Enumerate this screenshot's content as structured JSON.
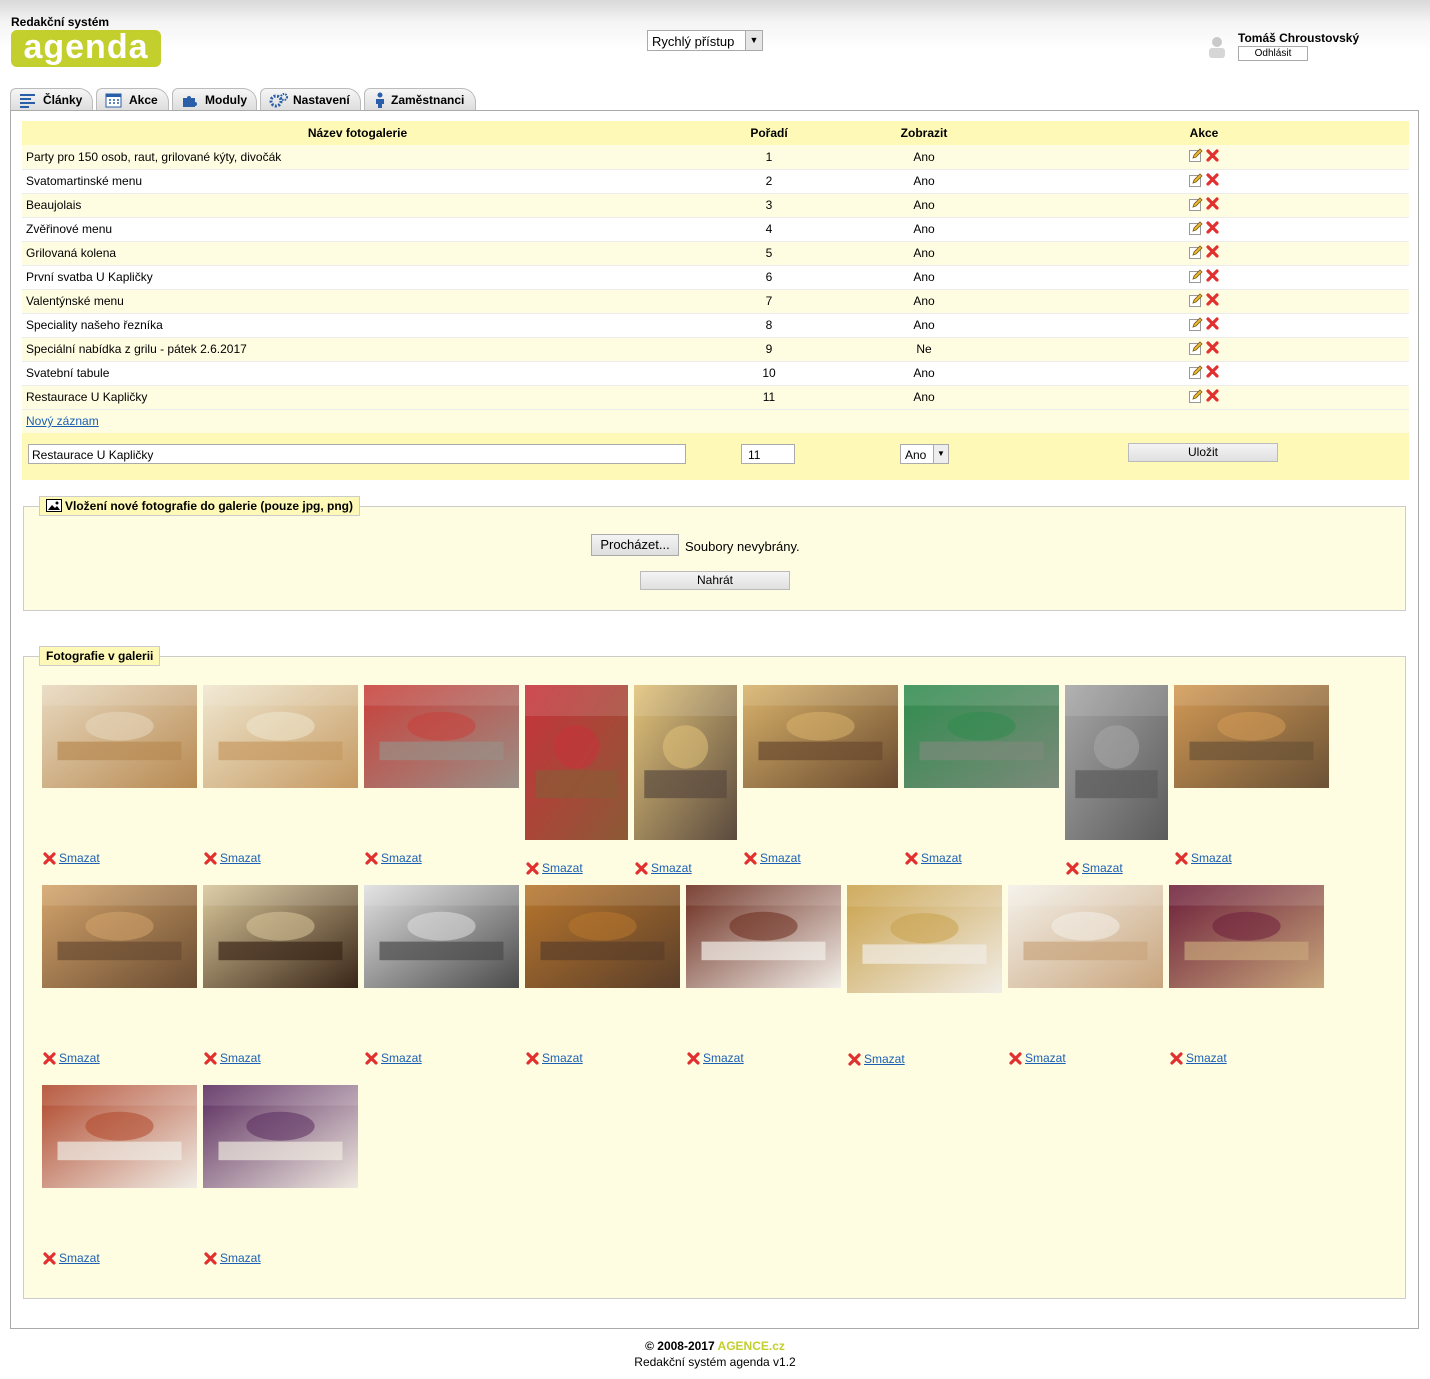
{
  "header": {
    "brand_subtitle": "Redakční systém",
    "logo_text": "agenda",
    "quick_access": "Rychlý přístup",
    "user_name": "Tomáš Chroustovský",
    "logout": "Odhlásit"
  },
  "tabs": [
    {
      "label": "Články",
      "icon": "lines-icon"
    },
    {
      "label": "Akce",
      "icon": "calendar-icon"
    },
    {
      "label": "Moduly",
      "icon": "puzzle-icon"
    },
    {
      "label": "Nastavení",
      "icon": "gears-icon"
    },
    {
      "label": "Zaměstnanci",
      "icon": "person-icon"
    }
  ],
  "table": {
    "headers": {
      "name": "Název fotogalerie",
      "order": "Pořadí",
      "show": "Zobrazit",
      "actions": "Akce"
    },
    "rows": [
      {
        "name": "Party pro 150 osob, raut, grilované kýty, divočák",
        "order": "1",
        "show": "Ano"
      },
      {
        "name": "Svatomartinské menu",
        "order": "2",
        "show": "Ano"
      },
      {
        "name": "Beaujolais",
        "order": "3",
        "show": "Ano"
      },
      {
        "name": "Zvěřinové menu",
        "order": "4",
        "show": "Ano"
      },
      {
        "name": "Grilovaná kolena",
        "order": "5",
        "show": "Ano"
      },
      {
        "name": "První svatba U Kapličky",
        "order": "6",
        "show": "Ano"
      },
      {
        "name": "Valentýnské menu",
        "order": "7",
        "show": "Ano"
      },
      {
        "name": "Speciality našeho řezníka",
        "order": "8",
        "show": "Ano"
      },
      {
        "name": "Speciální nabídka z grilu - pátek 2.6.2017",
        "order": "9",
        "show": "Ne"
      },
      {
        "name": "Svatební tabule",
        "order": "10",
        "show": "Ano"
      },
      {
        "name": "Restaurace U Kapličky",
        "order": "11",
        "show": "Ano"
      }
    ],
    "new_record": "Nový záznam"
  },
  "edit_form": {
    "name_value": "Restaurace U Kapličky",
    "order_value": "11",
    "show_value": "Ano",
    "save": "Uložit"
  },
  "upload": {
    "legend": "Vložení nové fotografie do galerie (pouze jpg, png)",
    "browse": "Procházet...",
    "no_files": "Soubory nevybrány.",
    "upload_button": "Nahrát"
  },
  "photos": {
    "legend": "Fotografie v galerii",
    "delete_label": "Smazat",
    "items": [
      {
        "scene": "restaurant-interior-icon",
        "c1": "#b88a52",
        "c2": "#e8d9bf"
      },
      {
        "scene": "dining-room-icon",
        "c1": "#c69a62",
        "c2": "#efe7cf"
      },
      {
        "scene": "terrace-red-chairs-icon",
        "c1": "#9a8f86",
        "c2": "#c9403a"
      },
      {
        "scene": "red-chairs-row-icon",
        "c1": "#8b5a36",
        "c2": "#c8323b"
      },
      {
        "scene": "beer-tap-icon",
        "c1": "#5a4a3e",
        "c2": "#e2c37a"
      },
      {
        "scene": "beer-taps-icon",
        "c1": "#6a4a2f",
        "c2": "#d9b36b"
      },
      {
        "scene": "garden-umbrellas-icon",
        "c1": "#7c8a7a",
        "c2": "#2f8c4e"
      },
      {
        "scene": "grill-oven-icon",
        "c1": "#5b5b5b",
        "c2": "#a7a7a7"
      },
      {
        "scene": "wine-cellar-table-icon",
        "c1": "#6b5236",
        "c2": "#d39a55"
      },
      {
        "scene": "wine-cellar-dining-icon",
        "c1": "#6a4c32",
        "c2": "#d4a46b"
      },
      {
        "scene": "wine-bottles-icon",
        "c1": "#3a2618",
        "c2": "#d9c79a"
      },
      {
        "scene": "chefs-icon",
        "c1": "#4b4b4b",
        "c2": "#e0e0e0"
      },
      {
        "scene": "staff-bar-icon",
        "c1": "#5b3f2a",
        "c2": "#b8762d"
      },
      {
        "scene": "steak-plate-icon",
        "c1": "#f2efe9",
        "c2": "#6b2b1d"
      },
      {
        "scene": "duck-plate-icon",
        "c1": "#f1ede6",
        "c2": "#c9a14a"
      },
      {
        "scene": "meat-plate-icon",
        "c1": "#c9a57d",
        "c2": "#f4f1ea"
      },
      {
        "scene": "pate-plate-icon",
        "c1": "#c7a57b",
        "c2": "#6d1f3a"
      },
      {
        "scene": "terrine-plate-icon",
        "c1": "#f0ede6",
        "c2": "#b0472a"
      },
      {
        "scene": "roast-duck-dumplings-icon",
        "c1": "#efe9e0",
        "c2": "#5a2b5e"
      }
    ]
  },
  "footer": {
    "copyright": "© 2008-2017 ",
    "brand": "AGENCE.cz",
    "version": "Redakční systém agenda v1.2"
  },
  "colors": {
    "accent": "#c2cf2c",
    "table_header": "#fef9b7",
    "row_alt": "#fffde1",
    "link": "#1a5fb4",
    "delete": "#e03030"
  }
}
